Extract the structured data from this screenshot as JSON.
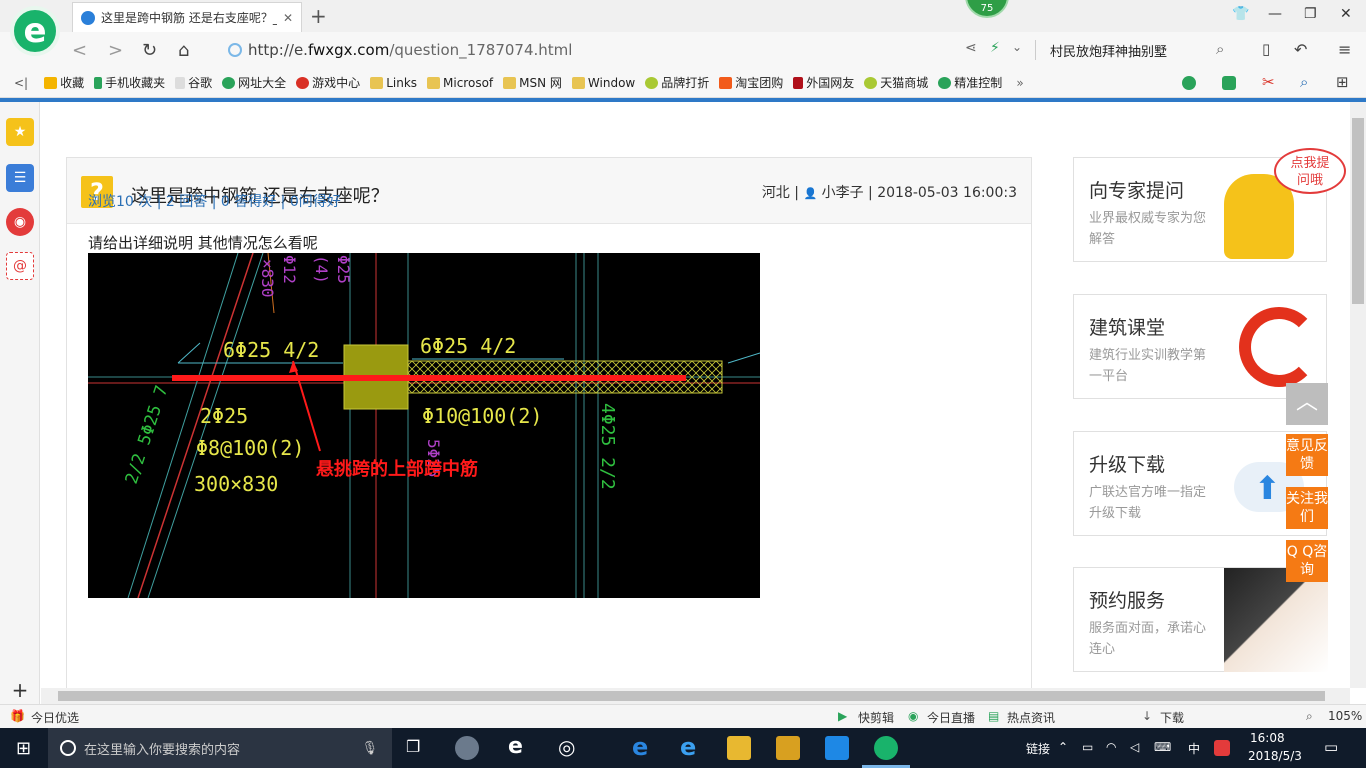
{
  "browser": {
    "tab_title": "这里是跨中钢筋 还是右支座呢？_",
    "tab_close": "✕",
    "new_tab": "+",
    "badge": "75",
    "url_scheme_host_prefix": "http://e.",
    "url_domain": "fwxgx.com",
    "url_path": "/question_1787074.html",
    "search_text": "村民放炮拜神抽别墅"
  },
  "bookmarks": [
    {
      "label": "收藏",
      "icon": "star-icon"
    },
    {
      "label": "手机收藏夹",
      "icon": "phone-icon"
    },
    {
      "label": "谷歌",
      "icon": "page-icon"
    },
    {
      "label": "网址大全",
      "icon": "globe-icon"
    },
    {
      "label": "游戏中心",
      "icon": "game-icon"
    },
    {
      "label": "Links",
      "icon": "folder-icon"
    },
    {
      "label": "Microsof",
      "icon": "folder-icon"
    },
    {
      "label": "MSN 网",
      "icon": "folder-icon"
    },
    {
      "label": "Window",
      "icon": "folder-icon"
    },
    {
      "label": "品牌打折",
      "icon": "leaf-icon"
    },
    {
      "label": "淘宝团购",
      "icon": "taobao-icon"
    },
    {
      "label": "外国网友",
      "icon": "bookmark-icon"
    },
    {
      "label": "天猫商城",
      "icon": "leaf-icon"
    },
    {
      "label": "精准控制",
      "icon": "chat-icon"
    }
  ],
  "question": {
    "title": "这里是跨中钢筋 还是右支座呢？",
    "location": "河北",
    "user": "小李子",
    "datetime": "2018-05-03 16:00:3",
    "stats": "浏览10 次 | 2 回答 | 0 答得好 | 0问得好",
    "description": "请给出详细说明    其他情况怎么看呢"
  },
  "cad": {
    "labels": {
      "left_top_rebar": "6Φ25 4/2",
      "right_top_rebar": "6Φ25 4/2",
      "left_bottom_rebar": "2Φ25",
      "stirrup_left": "Φ8@100(2)",
      "section": "300×830",
      "stirrup_right": "Φ10@100(2)",
      "vertical_right": "4Φ25 2/2",
      "vertical_mid": "5Φ25",
      "vertical_top_1": "(4)",
      "vertical_top_2": "Φ25",
      "vertical_top_3": "Φ12",
      "vertical_top_4": "×830",
      "diagonal_left": "2/2 5Φ25 7",
      "annotation": "悬挑跨的上部跨中筋"
    }
  },
  "sidebar_cards": [
    {
      "title": "向专家提问",
      "sub": "业界最权威专家为您解答",
      "bubble": "点我提问哦"
    },
    {
      "title": "建筑课堂",
      "sub": "建筑行业实训教学第一平台"
    },
    {
      "title": "升级下载",
      "sub": "广联达官方唯一指定升级下载"
    },
    {
      "title": "预约服务",
      "sub": "服务面对面，承诺心连心"
    }
  ],
  "float_buttons": {
    "to_top": "︿",
    "feedback": "意见反馈",
    "follow": "关注我们",
    "qq": "Q Q咨询"
  },
  "statusbar": {
    "left": "今日优选",
    "items": [
      "快剪辑",
      "今日直播",
      "热点资讯",
      "下载"
    ],
    "zoom": "105%"
  },
  "taskbar": {
    "search_placeholder": "在这里输入你要搜索的内容",
    "link_label": "链接",
    "ime": "中",
    "time": "16:08",
    "date": "2018/5/3"
  },
  "colors": {
    "accent_blue": "#2e79c7",
    "link_blue": "#2a6fb5",
    "orange": "#f57a14",
    "cad_yellow": "#e6e64a",
    "cad_red": "#ff1a1a"
  }
}
